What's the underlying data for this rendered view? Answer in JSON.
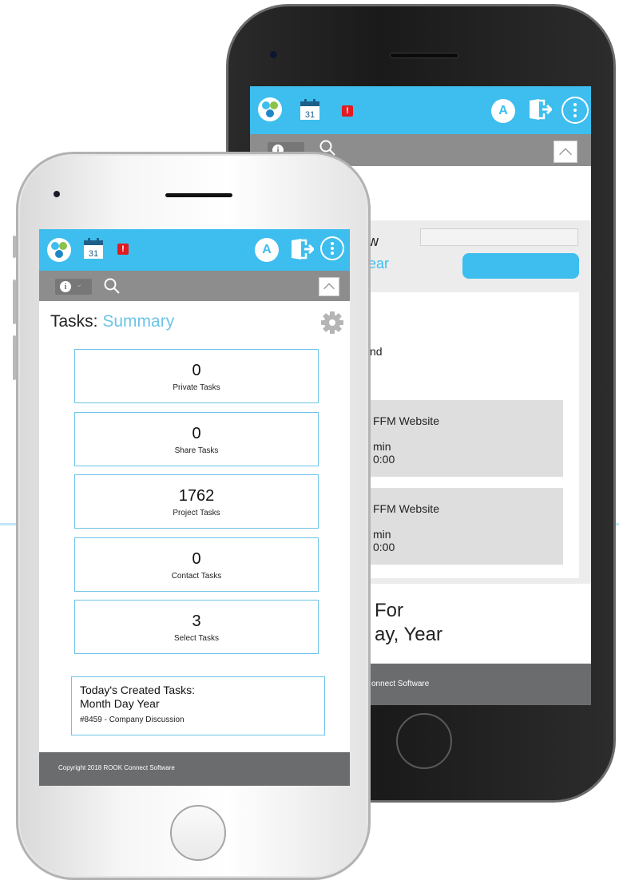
{
  "front": {
    "title_prefix": "Tasks:",
    "title_accent": "Summary",
    "avatar_letter": "A",
    "alert_mark": "!",
    "calendar_day": "31",
    "tasks": [
      {
        "count": "0",
        "label": "Private Tasks"
      },
      {
        "count": "0",
        "label": "Share Tasks"
      },
      {
        "count": "1762",
        "label": "Project Tasks"
      },
      {
        "count": "0",
        "label": "Contact Tasks"
      },
      {
        "count": "3",
        "label": "Select Tasks"
      }
    ],
    "today": {
      "title_line1": "Today's Created Tasks:",
      "title_line2": "Month Day Year",
      "item": "#8459 - Company Discussion"
    },
    "footer": "Copyright 2018 ROOK Connect Software"
  },
  "back": {
    "avatar_letter": "A",
    "alert_mark": "!",
    "calendar_day": "31",
    "label_w": "w",
    "label_ear": "ear",
    "label_nd": "nd",
    "card1_title": "FFM Website",
    "card1_line1": "min",
    "card1_line2": "0:00",
    "card2_title": "FFM Website",
    "card2_line1": "min",
    "card2_line2": "0:00",
    "heading_line1": "For",
    "heading_line2": "ay, Year",
    "footer": "onnect Software"
  },
  "colors": {
    "brand_blue": "#3dbeee",
    "toolbar_gray": "#8d8d8d",
    "footer_gray": "#6a6c6e",
    "alert_red": "#e11b22",
    "box_border": "#6cc4e8"
  },
  "icons": [
    "logo-icon",
    "calendar-icon",
    "alert-icon",
    "avatar-icon",
    "logout-icon",
    "menu-icon",
    "info-icon",
    "search-icon",
    "collapse-icon",
    "gear-icon"
  ]
}
